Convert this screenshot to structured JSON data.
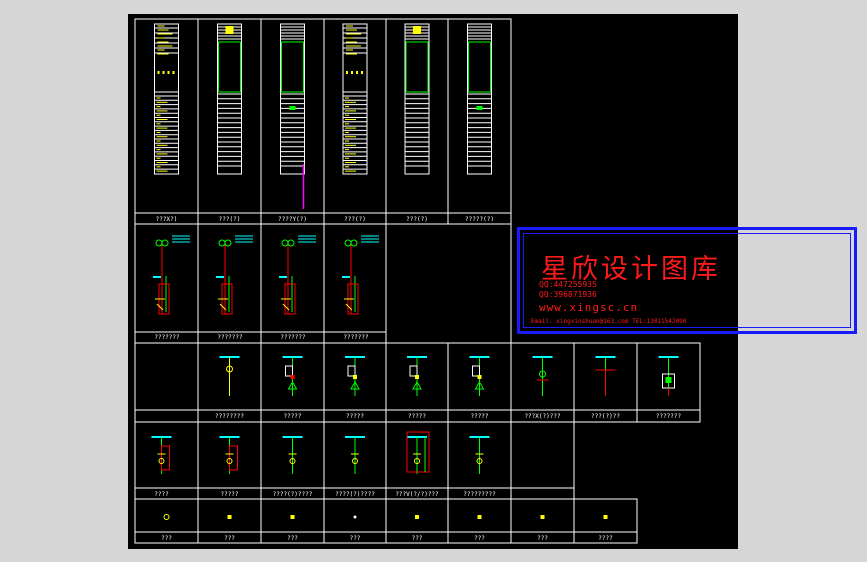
{
  "cells": {
    "row1": [
      "???X?)",
      "???(?)",
      "????Y(?)",
      "???(?)",
      "???(?)",
      "?????(?)"
    ],
    "row2": [
      "???????",
      "???????",
      "???????",
      "???????"
    ],
    "row3": [
      "",
      "????????",
      "?????",
      "?????",
      "?????",
      "?????",
      "???X(?)???",
      "???(?)??",
      "???????"
    ],
    "row4": [
      "????",
      "?????",
      "????(?)????",
      "????(?)????",
      "???V(?/?)???",
      "?????????"
    ],
    "row5": [
      "???",
      "???",
      "???",
      "???",
      "???",
      "???",
      "???",
      "????"
    ]
  },
  "watermark": {
    "title": "星欣设计图库",
    "qq1": "QQ:447255935",
    "qq2": "QQ:396871936",
    "url": "www.xingsc.cn",
    "contact": "Email: xingxinshuan@163.com    TEL:13011542090"
  },
  "colors": {
    "background": "#000000",
    "frame": "#ffffff",
    "symbol": "#ffff00",
    "bus": "#00ffff",
    "wire": "#00ff00",
    "accent": "#ff0000",
    "watermark_border": "#1a1aff"
  }
}
